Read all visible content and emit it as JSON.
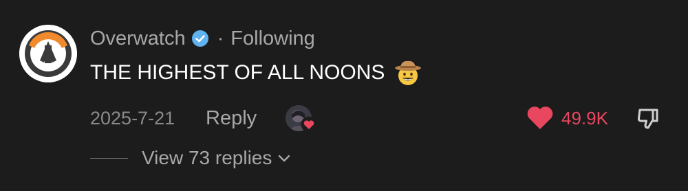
{
  "comment": {
    "author": "Overwatch",
    "separator": "·",
    "follow_status": "Following",
    "text": "THE HIGHEST OF ALL NOONS",
    "emoji": "cowboy-hat-face",
    "date": "2025-7-21",
    "reply_label": "Reply",
    "like_count": "49.9K",
    "view_replies_label": "View 73 replies"
  },
  "icons": {
    "avatar": "overwatch-logo",
    "verified": "verified-badge",
    "like": "heart-icon",
    "dislike": "thumbs-down-icon",
    "expand": "chevron-down-icon"
  },
  "colors": {
    "background": "#1c1c1c",
    "text_primary": "#ffffff",
    "text_secondary": "#a8a8a8",
    "like_accent": "#e8475f",
    "verified_blue": "#5fb3f0",
    "logo_orange": "#f08a2c"
  }
}
